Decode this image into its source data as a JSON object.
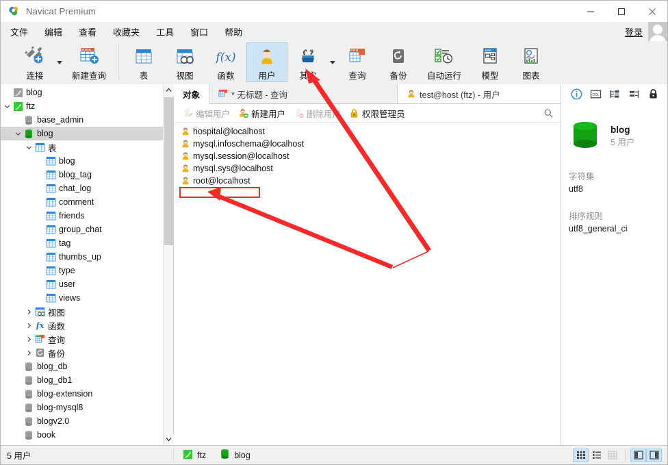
{
  "window": {
    "title": "Navicat Premium",
    "logo_icon": "navicat-logo-icon",
    "minimize": "—",
    "maximize": "□",
    "close": "✕"
  },
  "menubar": {
    "items": [
      {
        "label": "文件",
        "name": "menu-file"
      },
      {
        "label": "编辑",
        "name": "menu-edit"
      },
      {
        "label": "查看",
        "name": "menu-view"
      },
      {
        "label": "收藏夹",
        "name": "menu-favorites"
      },
      {
        "label": "工具",
        "name": "menu-tools"
      },
      {
        "label": "窗口",
        "name": "menu-window"
      },
      {
        "label": "帮助",
        "name": "menu-help"
      }
    ],
    "login_label": "登录",
    "avatar_icon": "user-avatar-icon"
  },
  "ribbon": {
    "groups": [
      {
        "buttons": [
          {
            "label": "连接",
            "name": "connection-button",
            "icon": "plug-plus-icon",
            "wide": false,
            "caret": true,
            "active": false
          },
          {
            "label": "新建查询",
            "name": "new-query-button",
            "icon": "new-query-icon",
            "wide": true,
            "caret": false,
            "active": false
          }
        ]
      },
      {
        "buttons": [
          {
            "label": "表",
            "name": "tables-button",
            "icon": "table-icon",
            "wide": false,
            "caret": false,
            "active": false
          },
          {
            "label": "视图",
            "name": "views-button",
            "icon": "view-icon",
            "wide": false,
            "caret": false,
            "active": false
          },
          {
            "label": "函数",
            "name": "functions-button",
            "icon": "function-icon",
            "wide": false,
            "caret": false,
            "active": false
          },
          {
            "label": "用户",
            "name": "users-button",
            "icon": "user-icon",
            "wide": false,
            "caret": false,
            "active": true
          },
          {
            "label": "其它",
            "name": "others-button",
            "icon": "tools-icon",
            "wide": false,
            "caret": true,
            "active": false
          },
          {
            "label": "查询",
            "name": "query-button",
            "icon": "query-icon",
            "wide": false,
            "caret": false,
            "active": false
          },
          {
            "label": "备份",
            "name": "backup-button",
            "icon": "backup-icon",
            "wide": false,
            "caret": false,
            "active": false
          },
          {
            "label": "自动运行",
            "name": "automation-button",
            "icon": "automation-icon",
            "wide": true,
            "caret": false,
            "active": false
          },
          {
            "label": "模型",
            "name": "model-button",
            "icon": "model-icon",
            "wide": false,
            "caret": false,
            "active": false
          },
          {
            "label": "图表",
            "name": "chart-button",
            "icon": "chart-icon",
            "wide": false,
            "caret": false,
            "active": false
          }
        ]
      }
    ]
  },
  "sidebar": {
    "nodes": [
      {
        "label": "blog",
        "indent": 0,
        "twist": "",
        "icon": "connection-gray-icon",
        "selected": false
      },
      {
        "label": "ftz",
        "indent": 0,
        "twist": "v",
        "icon": "connection-green-icon",
        "selected": false
      },
      {
        "label": "base_admin",
        "indent": 1,
        "twist": "",
        "icon": "database-gray-icon",
        "selected": false
      },
      {
        "label": "blog",
        "indent": 1,
        "twist": "v",
        "icon": "database-green-icon",
        "selected": true
      },
      {
        "label": "表",
        "indent": 2,
        "twist": "v",
        "icon": "table-icon",
        "selected": false
      },
      {
        "label": "blog",
        "indent": 3,
        "twist": "",
        "icon": "table-icon",
        "selected": false
      },
      {
        "label": "blog_tag",
        "indent": 3,
        "twist": "",
        "icon": "table-icon",
        "selected": false
      },
      {
        "label": "chat_log",
        "indent": 3,
        "twist": "",
        "icon": "table-icon",
        "selected": false
      },
      {
        "label": "comment",
        "indent": 3,
        "twist": "",
        "icon": "table-icon",
        "selected": false
      },
      {
        "label": "friends",
        "indent": 3,
        "twist": "",
        "icon": "table-icon",
        "selected": false
      },
      {
        "label": "group_chat",
        "indent": 3,
        "twist": "",
        "icon": "table-icon",
        "selected": false
      },
      {
        "label": "tag",
        "indent": 3,
        "twist": "",
        "icon": "table-icon",
        "selected": false
      },
      {
        "label": "thumbs_up",
        "indent": 3,
        "twist": "",
        "icon": "table-icon",
        "selected": false
      },
      {
        "label": "type",
        "indent": 3,
        "twist": "",
        "icon": "table-icon",
        "selected": false
      },
      {
        "label": "user",
        "indent": 3,
        "twist": "",
        "icon": "table-icon",
        "selected": false
      },
      {
        "label": "views",
        "indent": 3,
        "twist": "",
        "icon": "table-icon",
        "selected": false
      },
      {
        "label": "视图",
        "indent": 2,
        "twist": ">",
        "icon": "view-icon",
        "selected": false
      },
      {
        "label": "函数",
        "indent": 2,
        "twist": ">",
        "icon": "function-icon",
        "selected": false
      },
      {
        "label": "查询",
        "indent": 2,
        "twist": ">",
        "icon": "query-icon",
        "selected": false
      },
      {
        "label": "备份",
        "indent": 2,
        "twist": ">",
        "icon": "backup-icon",
        "selected": false
      },
      {
        "label": "blog_db",
        "indent": 1,
        "twist": "",
        "icon": "database-gray-icon",
        "selected": false
      },
      {
        "label": "blog_db1",
        "indent": 1,
        "twist": "",
        "icon": "database-gray-icon",
        "selected": false
      },
      {
        "label": "blog-extension",
        "indent": 1,
        "twist": "",
        "icon": "database-gray-icon",
        "selected": false
      },
      {
        "label": "blog-mysql8",
        "indent": 1,
        "twist": "",
        "icon": "database-gray-icon",
        "selected": false
      },
      {
        "label": "blogv2.0",
        "indent": 1,
        "twist": "",
        "icon": "database-gray-icon",
        "selected": false
      },
      {
        "label": "book",
        "indent": 1,
        "twist": "",
        "icon": "database-gray-icon",
        "selected": false
      }
    ],
    "scroll": {
      "up_arrow": "⌃",
      "down_arrow": "⌄"
    }
  },
  "main": {
    "tabs": [
      {
        "label": "对象",
        "name": "tab-objects",
        "icon": "",
        "active": true
      },
      {
        "label": "* 无标题 - 查询",
        "name": "tab-untitled-query",
        "icon": "query-icon",
        "active": false
      },
      {
        "label": "test@host (ftz) - 用户",
        "name": "tab-users",
        "icon": "user-small-icon",
        "active": false
      }
    ],
    "subtoolbar": [
      {
        "label": "编辑用户",
        "name": "edit-user-button",
        "icon": "edit-user-icon",
        "disabled": true
      },
      {
        "label": "新建用户",
        "name": "new-user-button",
        "icon": "new-user-icon",
        "disabled": false
      },
      {
        "label": "删除用户",
        "name": "delete-user-button",
        "icon": "delete-user-icon",
        "disabled": true
      },
      {
        "label": "权限管理员",
        "name": "privilege-manager-button",
        "icon": "lock-icon",
        "disabled": false
      }
    ],
    "search_icon": "search-icon",
    "users": [
      {
        "name": "hospital@localhost",
        "icon": "user-small-icon"
      },
      {
        "name": "mysql.infoschema@localhost",
        "icon": "user-small-icon"
      },
      {
        "name": "mysql.session@localhost",
        "icon": "user-small-icon"
      },
      {
        "name": "mysql.sys@localhost",
        "icon": "user-small-icon"
      },
      {
        "name": "root@localhost",
        "icon": "user-small-icon"
      }
    ]
  },
  "infopanel": {
    "tabs": [
      {
        "name": "info-tab",
        "icon": "info-circle-icon",
        "active": true
      },
      {
        "name": "ddl-tab",
        "icon": "ddl-icon",
        "active": false
      },
      {
        "name": "objects-tab",
        "icon": "object-tree-icon",
        "active": false
      },
      {
        "name": "structure-tab",
        "icon": "structure-icon",
        "active": false
      },
      {
        "name": "privileges-tab",
        "icon": "lock-icon",
        "active": false
      }
    ],
    "db_icon": "database-green-icon",
    "db_name": "blog",
    "db_sub": "5 用户",
    "fields": [
      {
        "key": "字符集",
        "value": "utf8"
      },
      {
        "key": "排序规则",
        "value": "utf8_general_ci"
      }
    ]
  },
  "statusbar": {
    "count": "5 用户",
    "connection": "ftz",
    "connection_icon": "connection-green-icon",
    "database": "blog",
    "database_icon": "database-green-icon",
    "view_buttons": [
      {
        "name": "grid-view-button",
        "icon": "grid-view-icon",
        "active": true
      },
      {
        "name": "list-view-button",
        "icon": "list-view-icon",
        "active": false
      },
      {
        "name": "detail-view-button",
        "icon": "detail-view-icon",
        "active": false
      },
      {
        "name": "left-pane-toggle",
        "icon": "left-pane-icon",
        "active": true
      },
      {
        "name": "right-pane-toggle",
        "icon": "right-pane-icon",
        "active": true
      }
    ]
  },
  "annotations": {
    "color": "#f62a2a",
    "highlight_box": "empty-row-highlight"
  }
}
